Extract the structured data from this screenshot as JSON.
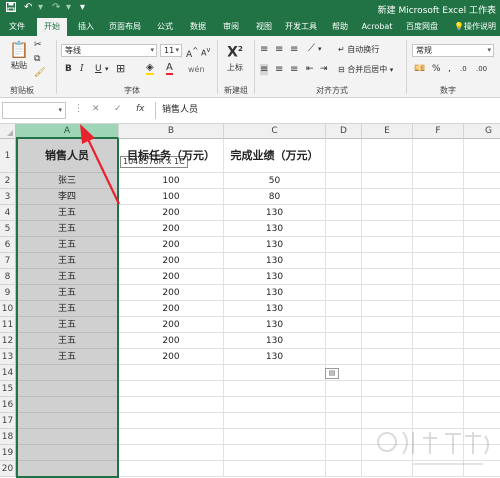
{
  "title_bar": {
    "document_title": "新建 Microsoft Excel 工作表",
    "quick_access": [
      {
        "icon": "save-icon",
        "glyph": "💾"
      },
      {
        "icon": "undo-icon",
        "glyph": "↶"
      },
      {
        "icon": "redo-icon",
        "glyph": "↷"
      },
      {
        "icon": "customize-icon",
        "glyph": "▾"
      }
    ]
  },
  "ribbon_tabs": {
    "tabs": [
      "文件",
      "开始",
      "插入",
      "页面布局",
      "公式",
      "数据",
      "审阅",
      "视图",
      "开发工具",
      "帮助",
      "Acrobat",
      "百度网盘"
    ],
    "active_index": 1,
    "search_label": "操作说明"
  },
  "ribbon": {
    "clipboard": {
      "paste_label": "粘贴",
      "group_label": "剪贴板"
    },
    "font": {
      "font_name": "等线",
      "font_size": "11",
      "group_label": "字体"
    },
    "new_group": {
      "superscript_label": "上标",
      "group_label": "新建组"
    },
    "alignment": {
      "wrap_label": "自动换行",
      "merge_label": "合并后居中",
      "group_label": "对齐方式"
    },
    "number": {
      "format_value": "常规",
      "group_label": "数字"
    }
  },
  "formula_bar": {
    "name_box_value": "",
    "fx_label": "fx",
    "formula_value": "销售人员"
  },
  "sheet": {
    "columns": [
      "A",
      "B",
      "C",
      "D",
      "E",
      "F",
      "G"
    ],
    "selected_column": "A",
    "row_numbers": [
      "1",
      "2",
      "3",
      "4",
      "5",
      "6",
      "7",
      "8",
      "9",
      "10",
      "11",
      "12",
      "13",
      "14",
      "15",
      "16",
      "17",
      "18",
      "19",
      "20"
    ],
    "header_row": [
      "销售人员",
      "目标任务（万元）",
      "完成业绩（万元）"
    ],
    "rows": [
      [
        "张三",
        "100",
        "50"
      ],
      [
        "李四",
        "100",
        "80"
      ],
      [
        "王五",
        "200",
        "130"
      ],
      [
        "王五",
        "200",
        "130"
      ],
      [
        "王五",
        "200",
        "130"
      ],
      [
        "王五",
        "200",
        "130"
      ],
      [
        "王五",
        "200",
        "130"
      ],
      [
        "王五",
        "200",
        "130"
      ],
      [
        "王五",
        "200",
        "130"
      ],
      [
        "王五",
        "200",
        "130"
      ],
      [
        "王五",
        "200",
        "130"
      ],
      [
        "王五",
        "200",
        "130"
      ]
    ],
    "selection_tooltip": "1048576R x 1C"
  },
  "colors": {
    "brand": "#217346",
    "selected_column_header": "#9fd5b7",
    "selected_cells": "#d0d0d0",
    "annotation_arrow": "#e8232e"
  }
}
